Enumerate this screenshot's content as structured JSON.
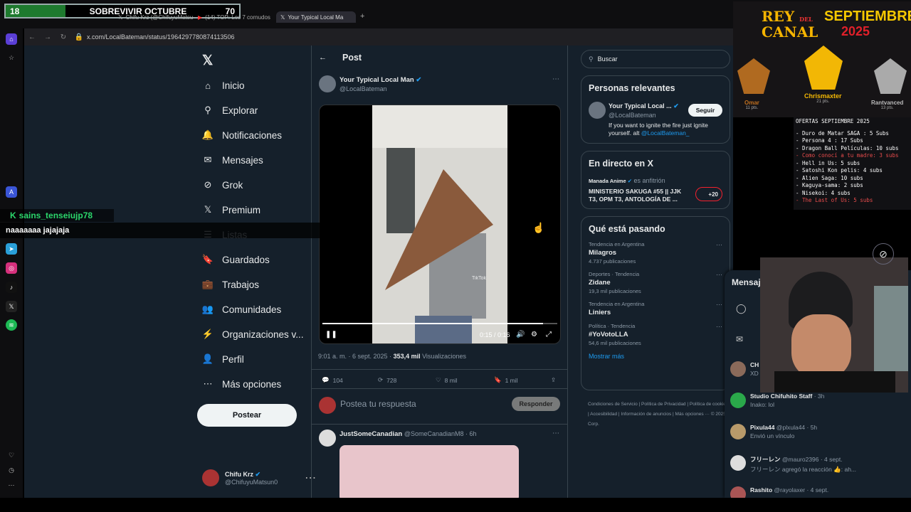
{
  "counter": {
    "left": "18",
    "title": "SOBREVIVIR OCTUBRE",
    "right": "70"
  },
  "tabs": [
    {
      "label": "Chifu Krz (@ChifuyuMatsu"
    },
    {
      "label": "(14) TOP: Los 7 cornudos"
    },
    {
      "label": "Your Typical Local Ma"
    }
  ],
  "url": "x.com/LocalBateman/status/1964297780874113506",
  "chat": {
    "user": "sains_tenseiujp78",
    "message": "naaaaaaa jajajaja"
  },
  "nav": [
    {
      "label": "Inicio",
      "icon": "home-icon",
      "glyph": "⌂"
    },
    {
      "label": "Explorar",
      "icon": "search-icon",
      "glyph": "⚲"
    },
    {
      "label": "Notificaciones",
      "icon": "bell-icon",
      "glyph": "🔔"
    },
    {
      "label": "Mensajes",
      "icon": "mail-icon",
      "glyph": "✉"
    },
    {
      "label": "Grok",
      "icon": "grok-icon",
      "glyph": "⊘"
    },
    {
      "label": "Premium",
      "icon": "x-logo-icon",
      "glyph": "𝕏"
    },
    {
      "label": "Listas",
      "icon": "list-icon",
      "glyph": "☰"
    },
    {
      "label": "Guardados",
      "icon": "bookmark-icon",
      "glyph": "🔖"
    },
    {
      "label": "Trabajos",
      "icon": "briefcase-icon",
      "glyph": "💼"
    },
    {
      "label": "Comunidades",
      "icon": "people-icon",
      "glyph": "👥"
    },
    {
      "label": "Organizaciones v...",
      "icon": "lightning-icon",
      "glyph": "⚡"
    },
    {
      "label": "Perfil",
      "icon": "person-icon",
      "glyph": "👤"
    },
    {
      "label": "Más opciones",
      "icon": "more-circle-icon",
      "glyph": "⋯"
    }
  ],
  "post_button": "Postear",
  "account": {
    "name": "Chifu Krz",
    "handle": "@ChifuyuMatsun0"
  },
  "post": {
    "header": "Post",
    "author": "Your Typical Local Man",
    "handle": "@LocalBateman",
    "time": "0:15 / 0:16",
    "timestamp": "9:01 a. m. · 6 sept. 2025 · ",
    "views_count": "353,4 mil",
    "views_label": " Visualizaciones",
    "replies": "104",
    "reposts": "728",
    "likes": "8 mil",
    "bookmarks": "1 mil",
    "watermark": "TikTok"
  },
  "reply": {
    "placeholder": "Postea tu respuesta",
    "button": "Responder"
  },
  "next_post": {
    "author": "JustSomeCanadian",
    "handle": "@SomeCanadianM8 · 6h"
  },
  "search_placeholder": "Buscar",
  "relevant": {
    "title": "Personas relevantes",
    "name": "Your Typical Local ...",
    "handle": "@LocalBateman",
    "follow": "Seguir",
    "bio": "If you want to ignite the fire just ignite yourself. alt ",
    "bio_link": "@LocalBateman_"
  },
  "live": {
    "title": "En directo en X",
    "host": "Manada Anime",
    "host_suffix": " es anfitrión",
    "text": "MINISTERIO SAKUGA #55 || JJK T3, OPM T3, ANTOLOGÍA DE ...",
    "count": "+20"
  },
  "trends": {
    "title": "Qué está pasando",
    "items": [
      {
        "category": "Tendencia en Argentina",
        "topic": "Milagros",
        "count": "4.737 publicaciones"
      },
      {
        "category": "Deportes · Tendencia",
        "topic": "Zidane",
        "count": "19,3 mil publicaciones"
      },
      {
        "category": "Tendencia en Argentina",
        "topic": "Liniers",
        "count": ""
      },
      {
        "category": "Política · Tendencia",
        "topic": "#YoVotoLLA",
        "count": "54,6 mil publicaciones"
      }
    ],
    "more": "Mostrar más"
  },
  "footer": [
    "Condiciones de Servicio",
    "Política de Privacidad",
    "Política de cookies",
    "Accesibilidad",
    "Información de anuncios",
    "Más opciones ···",
    "© 2025 X Corp."
  ],
  "overlay": {
    "title_left": "REY",
    "title_mid": "DEL",
    "title_left2": "CANAL",
    "title_right": "SEPTIEMBRE",
    "year": "2025",
    "p1": {
      "name": "Omar",
      "pts": "11 pts."
    },
    "p2": {
      "name": "Chrismaxter",
      "pts": "21 pts."
    },
    "p3": {
      "name": "Rantvanced",
      "pts": "13 pts."
    }
  },
  "offers": {
    "title": "OFERTAS SEPTIEMBRE 2025",
    "items": [
      "- Duro de Matar SAGA : 5 Subs",
      "- Persona 4 : 17 Subs",
      "- Dragon Ball Películas: 10 subs",
      "- Como conocí a tu madre: 3 subs",
      "- Hell in Us: 5 subs",
      "- Satoshi Kon pelis: 4 subs",
      "- Alien Saga: 10 subs",
      "- Kaguya-sama: 2 subs",
      "- Nisekoi: 4 subs",
      "- The Last of Us: 5 subs"
    ]
  },
  "messages": {
    "title": "Mensajes",
    "items": [
      {
        "name": "CH",
        "handle": "",
        "text": "XD"
      },
      {
        "name": "Studio Chifuhito Staff",
        "handle": " · 3h",
        "text": "Inako: lol"
      },
      {
        "name": "Pixula44",
        "handle": " @plxula44 · 5h",
        "text": "Envió un vínculo"
      },
      {
        "name": "フリーレン",
        "handle": " @mauro2396 · 4 sept.",
        "text": "フリーレン agregó la reacción 👍: ah..."
      },
      {
        "name": "Rashito",
        "handle": " @rayolaxer · 4 sept.",
        "text": ""
      }
    ]
  }
}
